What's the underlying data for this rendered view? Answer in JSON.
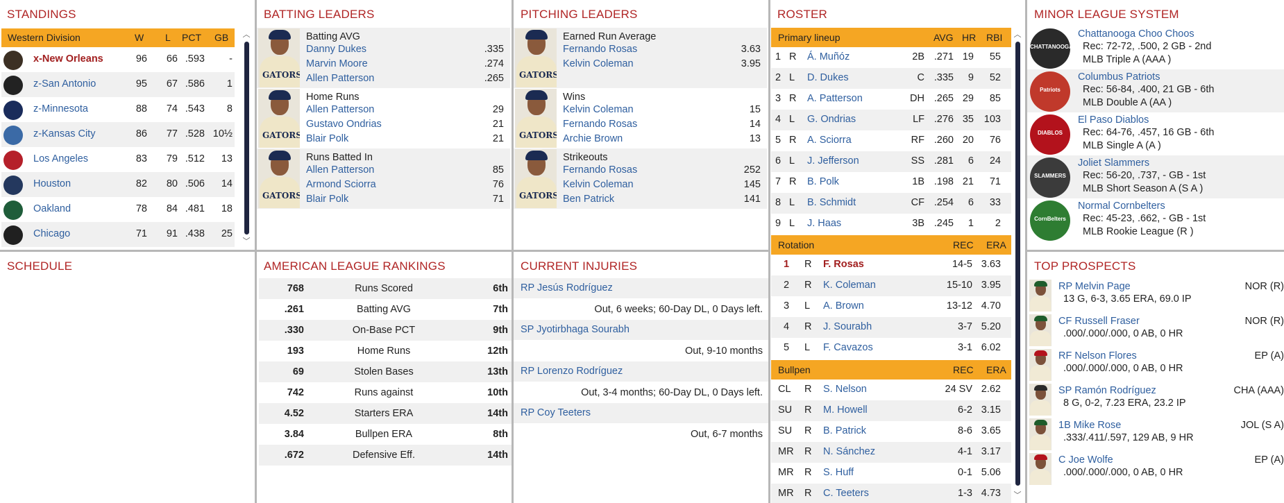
{
  "standings": {
    "title": "STANDINGS",
    "division": "Western Division",
    "cols": [
      "W",
      "L",
      "PCT",
      "GB"
    ],
    "rows": [
      {
        "team": "x-New Orleans",
        "w": "96",
        "l": "66",
        "pct": ".593",
        "gb": "-",
        "highlight": true,
        "color": "#3c3024"
      },
      {
        "team": "z-San Antonio",
        "w": "95",
        "l": "67",
        "pct": ".586",
        "gb": "1",
        "color": "#222222"
      },
      {
        "team": "z-Minnesota",
        "w": "88",
        "l": "74",
        "pct": ".543",
        "gb": "8",
        "color": "#1a2c5b"
      },
      {
        "team": "z-Kansas City",
        "w": "86",
        "l": "77",
        "pct": ".528",
        "gb": "10½",
        "color": "#3b6aa6"
      },
      {
        "team": "Los Angeles",
        "w": "83",
        "l": "79",
        "pct": ".512",
        "gb": "13",
        "color": "#b5202a"
      },
      {
        "team": "Houston",
        "w": "82",
        "l": "80",
        "pct": ".506",
        "gb": "14",
        "color": "#24385e"
      },
      {
        "team": "Oakland",
        "w": "78",
        "l": "84",
        "pct": ".481",
        "gb": "18",
        "color": "#1f5d3a"
      },
      {
        "team": "Chicago",
        "w": "71",
        "l": "91",
        "pct": ".438",
        "gb": "25",
        "color": "#202020"
      }
    ]
  },
  "batting_leaders": {
    "title": "BATTING LEADERS",
    "blocks": [
      {
        "category": "Batting AVG",
        "leaders": [
          {
            "name": "Danny Dukes",
            "value": ".335"
          },
          {
            "name": "Marvin Moore",
            "value": ".274"
          },
          {
            "name": "Allen Patterson",
            "value": ".265"
          }
        ]
      },
      {
        "category": "Home Runs",
        "leaders": [
          {
            "name": "Allen Patterson",
            "value": "29"
          },
          {
            "name": "Gustavo Ondrias",
            "value": "21"
          },
          {
            "name": "Blair Polk",
            "value": "21"
          }
        ]
      },
      {
        "category": "Runs Batted In",
        "leaders": [
          {
            "name": "Allen Patterson",
            "value": "85"
          },
          {
            "name": "Armond Sciorra",
            "value": "76"
          },
          {
            "name": "Blair Polk",
            "value": "71"
          }
        ]
      }
    ]
  },
  "pitching_leaders": {
    "title": "PITCHING LEADERS",
    "blocks": [
      {
        "category": "Earned Run Average",
        "leaders": [
          {
            "name": "Fernando Rosas",
            "value": "3.63"
          },
          {
            "name": "Kelvin Coleman",
            "value": "3.95"
          }
        ]
      },
      {
        "category": "Wins",
        "leaders": [
          {
            "name": "Kelvin Coleman",
            "value": "15"
          },
          {
            "name": "Fernando Rosas",
            "value": "14"
          },
          {
            "name": "Archie Brown",
            "value": "13"
          }
        ]
      },
      {
        "category": "Strikeouts",
        "leaders": [
          {
            "name": "Fernando Rosas",
            "value": "252"
          },
          {
            "name": "Kelvin Coleman",
            "value": "145"
          },
          {
            "name": "Ben Patrick",
            "value": "141"
          }
        ]
      }
    ]
  },
  "jersey_text": "GATORS",
  "roster": {
    "title": "ROSTER",
    "lineup_header": {
      "label": "Primary lineup",
      "avg": "AVG",
      "hr": "HR",
      "rbi": "RBI"
    },
    "lineup": [
      {
        "n": "1",
        "h": "R",
        "name": "Á. Muñóz",
        "pos": "2B",
        "avg": ".271",
        "hr": "19",
        "rbi": "55"
      },
      {
        "n": "2",
        "h": "L",
        "name": "D. Dukes",
        "pos": "C",
        "avg": ".335",
        "hr": "9",
        "rbi": "52"
      },
      {
        "n": "3",
        "h": "R",
        "name": "A. Patterson",
        "pos": "DH",
        "avg": ".265",
        "hr": "29",
        "rbi": "85"
      },
      {
        "n": "4",
        "h": "L",
        "name": "G. Ondrias",
        "pos": "LF",
        "avg": ".276",
        "hr": "35",
        "rbi": "103"
      },
      {
        "n": "5",
        "h": "R",
        "name": "A. Sciorra",
        "pos": "RF",
        "avg": ".260",
        "hr": "20",
        "rbi": "76"
      },
      {
        "n": "6",
        "h": "L",
        "name": "J. Jefferson",
        "pos": "SS",
        "avg": ".281",
        "hr": "6",
        "rbi": "24"
      },
      {
        "n": "7",
        "h": "R",
        "name": "B. Polk",
        "pos": "1B",
        "avg": ".198",
        "hr": "21",
        "rbi": "71"
      },
      {
        "n": "8",
        "h": "L",
        "name": "B. Schmidt",
        "pos": "CF",
        "avg": ".254",
        "hr": "6",
        "rbi": "33"
      },
      {
        "n": "9",
        "h": "L",
        "name": "J. Haas",
        "pos": "3B",
        "avg": ".245",
        "hr": "1",
        "rbi": "2"
      }
    ],
    "rotation_header": {
      "label": "Rotation",
      "rec": "REC",
      "era": "ERA"
    },
    "rotation": [
      {
        "n": "1",
        "h": "R",
        "name": "F. Rosas",
        "rec": "14-5",
        "era": "3.63",
        "highlight": true
      },
      {
        "n": "2",
        "h": "R",
        "name": "K. Coleman",
        "rec": "15-10",
        "era": "3.95"
      },
      {
        "n": "3",
        "h": "L",
        "name": "A. Brown",
        "rec": "13-12",
        "era": "4.70"
      },
      {
        "n": "4",
        "h": "R",
        "name": "J. Sourabh",
        "rec": "3-7",
        "era": "5.20"
      },
      {
        "n": "5",
        "h": "L",
        "name": "F. Cavazos",
        "rec": "3-1",
        "era": "6.02"
      }
    ],
    "bullpen_header": {
      "label": "Bullpen",
      "rec": "REC",
      "era": "ERA"
    },
    "bullpen": [
      {
        "role": "CL",
        "h": "R",
        "name": "S. Nelson",
        "rec": "24 SV",
        "era": "2.62"
      },
      {
        "role": "SU",
        "h": "R",
        "name": "M. Howell",
        "rec": "6-2",
        "era": "3.15"
      },
      {
        "role": "SU",
        "h": "R",
        "name": "B. Patrick",
        "rec": "8-6",
        "era": "3.65"
      },
      {
        "role": "MR",
        "h": "R",
        "name": "N. Sánchez",
        "rec": "4-1",
        "era": "3.17"
      },
      {
        "role": "MR",
        "h": "R",
        "name": "S. Huff",
        "rec": "0-1",
        "era": "5.06"
      },
      {
        "role": "MR",
        "h": "R",
        "name": "C. Teeters",
        "rec": "1-3",
        "era": "4.73"
      }
    ]
  },
  "minor_league": {
    "title": "MINOR LEAGUE SYSTEM",
    "teams": [
      {
        "name": "Chattanooga Choo Choos",
        "record": "Rec: 72-72, .500, 2 GB - 2nd",
        "level": "MLB Triple A (AAA )",
        "color": "#2a2a2a",
        "logo_text": "CHATTANOOGA"
      },
      {
        "name": "Columbus Patriots",
        "record": "Rec: 56-84, .400, 21 GB - 6th",
        "level": "MLB Double A (AA )",
        "color": "#c0392b",
        "logo_text": "Patriots"
      },
      {
        "name": "El Paso Diablos",
        "record": "Rec: 64-76, .457, 16 GB - 6th",
        "level": "MLB Single A (A )",
        "color": "#b3121c",
        "logo_text": "DIABLOS"
      },
      {
        "name": "Joliet Slammers",
        "record": "Rec: 56-20, .737, - GB - 1st",
        "level": "MLB Short Season A (S A )",
        "color": "#3b3b3b",
        "logo_text": "SLAMMERS"
      },
      {
        "name": "Normal Cornbelters",
        "record": "Rec: 45-23, .662, - GB - 1st",
        "level": "MLB Rookie League (R )",
        "color": "#2e7d32",
        "logo_text": "CornBelters"
      }
    ]
  },
  "schedule": {
    "title": "SCHEDULE"
  },
  "rankings": {
    "title": "AMERICAN LEAGUE RANKINGS",
    "rows": [
      {
        "value": "768",
        "stat": "Runs Scored",
        "rank": "6th"
      },
      {
        "value": ".261",
        "stat": "Batting AVG",
        "rank": "7th"
      },
      {
        "value": ".330",
        "stat": "On-Base PCT",
        "rank": "9th"
      },
      {
        "value": "193",
        "stat": "Home Runs",
        "rank": "12th"
      },
      {
        "value": "69",
        "stat": "Stolen Bases",
        "rank": "13th"
      },
      {
        "value": "742",
        "stat": "Runs against",
        "rank": "10th"
      },
      {
        "value": "4.52",
        "stat": "Starters ERA",
        "rank": "14th"
      },
      {
        "value": "3.84",
        "stat": "Bullpen ERA",
        "rank": "8th"
      },
      {
        "value": ".672",
        "stat": "Defensive Eff.",
        "rank": "14th"
      }
    ]
  },
  "injuries": {
    "title": "CURRENT INJURIES",
    "rows": [
      {
        "name": "RP Jesús Rodríguez",
        "status": "Out, 6 weeks; 60-Day DL, 0 Days left."
      },
      {
        "name": "SP Jyotirbhaga Sourabh",
        "status": "Out, 9-10 months"
      },
      {
        "name": "RP Lorenzo Rodríguez",
        "status": "Out, 3-4 months; 60-Day DL, 0 Days left."
      },
      {
        "name": "RP Coy Teeters",
        "status": "Out, 6-7 months"
      }
    ]
  },
  "prospects": {
    "title": "TOP PROSPECTS",
    "rows": [
      {
        "name": "RP Melvin Page",
        "team": "NOR (R)",
        "line": "13 G, 6-3, 3.65 ERA, 69.0 IP",
        "cap": "#1e5c2b"
      },
      {
        "name": "CF Russell Fraser",
        "team": "NOR (R)",
        "line": ".000/.000/.000, 0 AB, 0 HR",
        "cap": "#1e5c2b"
      },
      {
        "name": "RF Nelson Flores",
        "team": "EP (A)",
        "line": ".000/.000/.000, 0 AB, 0 HR",
        "cap": "#b3121c"
      },
      {
        "name": "SP Ramón Rodríguez",
        "team": "CHA (AAA)",
        "line": "8 G, 0-2, 7.23 ERA, 23.2 IP",
        "cap": "#2a2a2a"
      },
      {
        "name": "1B Mike Rose",
        "team": "JOL (S A)",
        "line": ".333/.411/.597, 129 AB, 9 HR",
        "cap": "#1e5c2b"
      },
      {
        "name": "C Joe Wolfe",
        "team": "EP (A)",
        "line": ".000/.000/.000, 0 AB, 0 HR",
        "cap": "#b3121c"
      }
    ]
  }
}
